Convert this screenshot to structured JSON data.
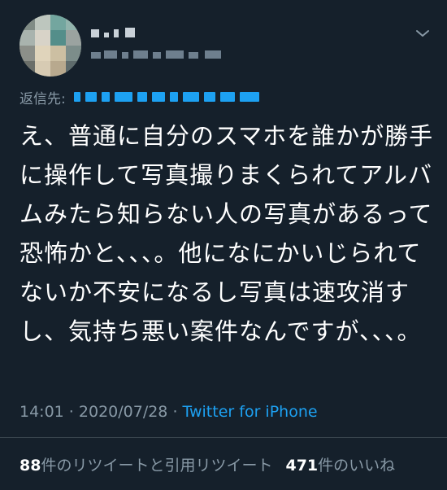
{
  "tweet": {
    "reply_label": "返信先:",
    "text": "え、普通に自分のスマホを誰かが勝手に操作して写真撮りまくられてアルバムみたら知らない人の写真があるって恐怖かと、、、。他になにかいじられてないか不安になるし写真は速攻消すし、気持ち悪い案件なんですが、、、。",
    "time": "14:01",
    "date": "2020/07/28",
    "source": "Twitter for iPhone",
    "separator": " · "
  },
  "stats": {
    "retweets": "88",
    "retweets_label": "件のリツイートと引用リツイート",
    "likes": "471",
    "likes_label": "件のいいね"
  },
  "colors": {
    "background": "#15202b",
    "secondary_text": "#8899a6",
    "accent": "#1da1f2"
  },
  "icons": {
    "menu": "chevron-down-icon"
  }
}
